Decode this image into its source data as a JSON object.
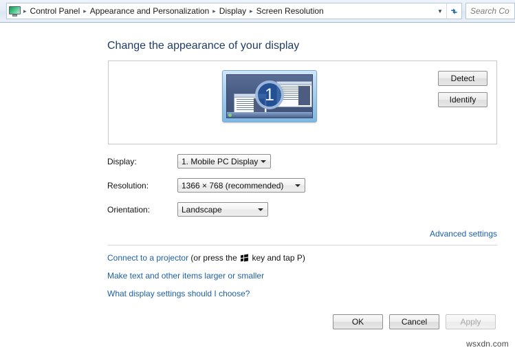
{
  "addressbar": {
    "icon": "monitor-icon",
    "back_icon": "back-arrow-icon",
    "breadcrumbs": [
      "Control Panel",
      "Appearance and Personalization",
      "Display",
      "Screen Resolution"
    ],
    "separator": "▸",
    "dropdown_icon": "chevron-down-icon",
    "refresh_icon": "refresh-icon",
    "search_placeholder": "Search Co"
  },
  "page": {
    "heading": "Change the appearance of your display"
  },
  "preview": {
    "monitor_number": "1",
    "monitor_icon": "display-thumbnail-icon",
    "detect_label": "Detect",
    "identify_label": "Identify"
  },
  "form": {
    "display_label": "Display:",
    "display_value": "1. Mobile PC Display",
    "resolution_label": "Resolution:",
    "resolution_value": "1366 × 768 (recommended)",
    "orientation_label": "Orientation:",
    "orientation_value": "Landscape"
  },
  "links": {
    "advanced": "Advanced settings",
    "projector_link": "Connect to a projector",
    "projector_text_before": " (or press the ",
    "projector_text_after": " key and tap P)",
    "windows_key_icon": "windows-logo-icon",
    "larger_text": "Make text and other items larger or smaller",
    "choose_settings": "What display settings should I choose?"
  },
  "buttons": {
    "ok": "OK",
    "cancel": "Cancel",
    "apply": "Apply"
  },
  "footer": {
    "watermark": "wsxdn.com"
  },
  "colors": {
    "heading": "#1f3c63",
    "link": "#1c5fa8",
    "addressbar_bg": "#e4ecf6",
    "monitor_desktop": "#4a5d85",
    "monitor_number_circle": "#1e4e96"
  }
}
